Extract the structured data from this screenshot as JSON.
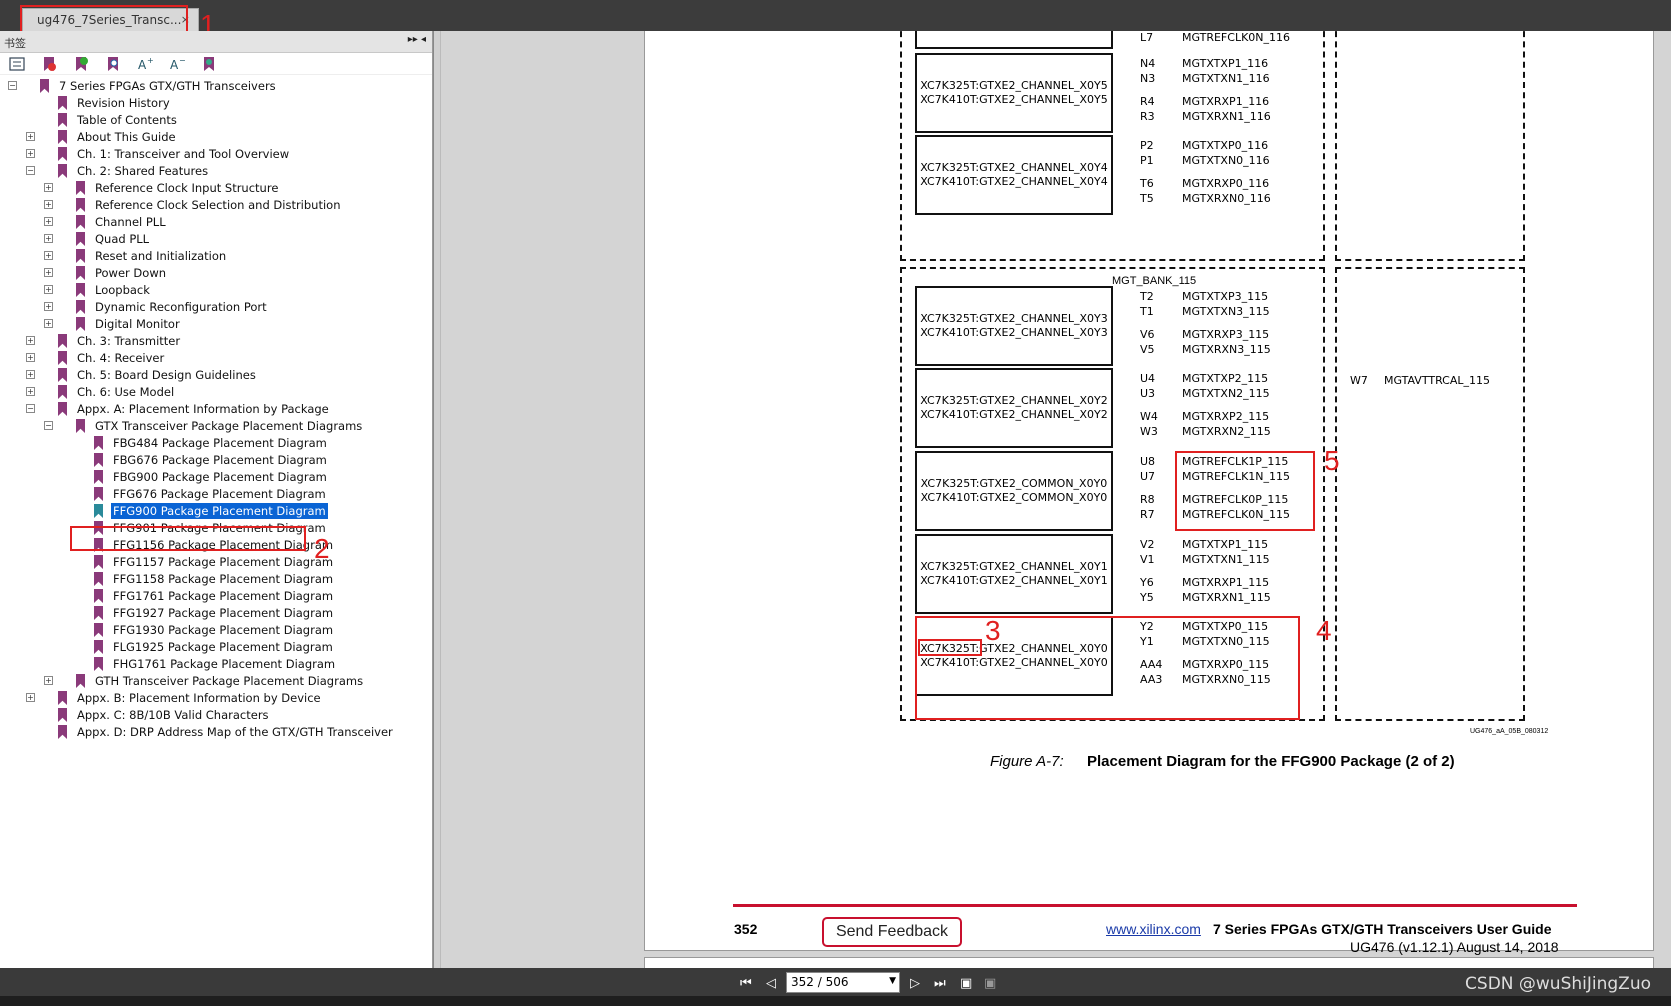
{
  "tab": {
    "title": "ug476_7Series_Transc...",
    "close": "×"
  },
  "annotations": {
    "a1": "1",
    "a2": "2",
    "a3": "3",
    "a4": "4",
    "a5": "5"
  },
  "sidebar": {
    "header": "书签",
    "header_controls": "▸▸ ◂"
  },
  "tree": [
    {
      "label": "7 Series FPGAs GTX/GTH Transceivers",
      "level": 0,
      "exp": "−"
    },
    {
      "label": "Revision History",
      "level": 1
    },
    {
      "label": "Table of Contents",
      "level": 1
    },
    {
      "label": "About This Guide",
      "level": 1,
      "exp": "+"
    },
    {
      "label": "Ch. 1: Transceiver and Tool Overview",
      "level": 1,
      "exp": "+"
    },
    {
      "label": "Ch. 2: Shared Features",
      "level": 1,
      "exp": "−"
    },
    {
      "label": "Reference Clock Input Structure",
      "level": 2,
      "exp": "+"
    },
    {
      "label": "Reference Clock Selection and Distribution",
      "level": 2,
      "exp": "+"
    },
    {
      "label": "Channel PLL",
      "level": 2,
      "exp": "+"
    },
    {
      "label": "Quad PLL",
      "level": 2,
      "exp": "+"
    },
    {
      "label": "Reset and Initialization",
      "level": 2,
      "exp": "+"
    },
    {
      "label": "Power Down",
      "level": 2,
      "exp": "+"
    },
    {
      "label": "Loopback",
      "level": 2,
      "exp": "+"
    },
    {
      "label": "Dynamic Reconfiguration Port",
      "level": 2,
      "exp": "+"
    },
    {
      "label": "Digital Monitor",
      "level": 2,
      "exp": "+"
    },
    {
      "label": "Ch. 3: Transmitter",
      "level": 1,
      "exp": "+"
    },
    {
      "label": "Ch. 4: Receiver",
      "level": 1,
      "exp": "+"
    },
    {
      "label": "Ch. 5: Board Design Guidelines",
      "level": 1,
      "exp": "+"
    },
    {
      "label": "Ch. 6: Use Model",
      "level": 1,
      "exp": "+"
    },
    {
      "label": "Appx. A: Placement Information by Package",
      "level": 1,
      "exp": "−"
    },
    {
      "label": "GTX Transceiver Package Placement Diagrams",
      "level": 2,
      "exp": "−"
    },
    {
      "label": "FBG484 Package Placement Diagram",
      "level": 3
    },
    {
      "label": "FBG676 Package Placement Diagram",
      "level": 3
    },
    {
      "label": "FBG900 Package Placement Diagram",
      "level": 3
    },
    {
      "label": "FFG676 Package Placement Diagram",
      "level": 3
    },
    {
      "label": "FFG900 Package Placement Diagram",
      "level": 3,
      "selected": true
    },
    {
      "label": "FFG901 Package Placement Diagram",
      "level": 3
    },
    {
      "label": "FFG1156 Package Placement Diagram",
      "level": 3
    },
    {
      "label": "FFG1157 Package Placement Diagram",
      "level": 3
    },
    {
      "label": "FFG1158 Package Placement Diagram",
      "level": 3
    },
    {
      "label": "FFG1761 Package Placement Diagram",
      "level": 3
    },
    {
      "label": "FFG1927 Package Placement Diagram",
      "level": 3
    },
    {
      "label": "FFG1930 Package Placement Diagram",
      "level": 3
    },
    {
      "label": "FLG1925 Package Placement Diagram",
      "level": 3
    },
    {
      "label": "FHG1761 Package Placement Diagram",
      "level": 3
    },
    {
      "label": "GTH Transceiver Package Placement Diagrams",
      "level": 2,
      "exp": "+"
    },
    {
      "label": "Appx. B: Placement Information by Device",
      "level": 1,
      "exp": "+"
    },
    {
      "label": "Appx. C: 8B/10B Valid Characters",
      "level": 1
    },
    {
      "label": "Appx. D: DRP Address Map of the GTX/GTH Transceiver",
      "level": 1
    }
  ],
  "diagram": {
    "bank_label": "MGT_BANK_115",
    "top_pins": [
      [
        "L7",
        "MGTREFCLK0N_116"
      ]
    ],
    "ch116": [
      {
        "l1": "XC7K325T:GTXE2_CHANNEL_X0Y5",
        "l2": "XC7K410T:GTXE2_CHANNEL_X0Y5",
        "pins": [
          [
            "N4",
            "MGTXTXP1_116"
          ],
          [
            "N3",
            "MGTXTXN1_116"
          ],
          [
            "R4",
            "MGTXRXP1_116"
          ],
          [
            "R3",
            "MGTXRXN1_116"
          ]
        ]
      },
      {
        "l1": "XC7K325T:GTXE2_CHANNEL_X0Y4",
        "l2": "XC7K410T:GTXE2_CHANNEL_X0Y4",
        "pins": [
          [
            "P2",
            "MGTXTXP0_116"
          ],
          [
            "P1",
            "MGTXTXN0_116"
          ],
          [
            "T6",
            "MGTXRXP0_116"
          ],
          [
            "T5",
            "MGTXRXN0_116"
          ]
        ]
      }
    ],
    "ch115": [
      {
        "l1": "XC7K325T:GTXE2_CHANNEL_X0Y3",
        "l2": "XC7K410T:GTXE2_CHANNEL_X0Y3",
        "pins": [
          [
            "T2",
            "MGTXTXP3_115"
          ],
          [
            "T1",
            "MGTXTXN3_115"
          ],
          [
            "V6",
            "MGTXRXP3_115"
          ],
          [
            "V5",
            "MGTXRXN3_115"
          ]
        ]
      },
      {
        "l1": "XC7K325T:GTXE2_CHANNEL_X0Y2",
        "l2": "XC7K410T:GTXE2_CHANNEL_X0Y2",
        "pins": [
          [
            "U4",
            "MGTXTXP2_115"
          ],
          [
            "U3",
            "MGTXTXN2_115"
          ],
          [
            "W4",
            "MGTXRXP2_115"
          ],
          [
            "W3",
            "MGTXRXN2_115"
          ]
        ]
      },
      {
        "l1": "XC7K325T:GTXE2_COMMON_X0Y0",
        "l2": "XC7K410T:GTXE2_COMMON_X0Y0",
        "pins": [
          [
            "U8",
            "MGTREFCLK1P_115"
          ],
          [
            "U7",
            "MGTREFCLK1N_115"
          ],
          [
            "R8",
            "MGTREFCLK0P_115"
          ],
          [
            "R7",
            "MGTREFCLK0N_115"
          ]
        ]
      },
      {
        "l1": "XC7K325T:GTXE2_CHANNEL_X0Y1",
        "l2": "XC7K410T:GTXE2_CHANNEL_X0Y1",
        "pins": [
          [
            "V2",
            "MGTXTXP1_115"
          ],
          [
            "V1",
            "MGTXTXN1_115"
          ],
          [
            "Y6",
            "MGTXRXP1_115"
          ],
          [
            "Y5",
            "MGTXRXN1_115"
          ]
        ]
      },
      {
        "l1": "XC7K325T:GTXE2_CHANNEL_X0Y0",
        "l2": "XC7K410T:GTXE2_CHANNEL_X0Y0",
        "pins": [
          [
            "Y2",
            "MGTXTXP0_115"
          ],
          [
            "Y1",
            "MGTXTXN0_115"
          ],
          [
            "AA4",
            "MGTXRXP0_115"
          ],
          [
            "AA3",
            "MGTXRXN0_115"
          ]
        ]
      }
    ],
    "right_pin": [
      "W7",
      "MGTAVTTRCAL_115"
    ],
    "fig_id": "UG476_aA_05B_080312",
    "caption_num": "Figure A-7:",
    "caption_text": "Placement Diagram for the FFG900 Package (2 of 2)"
  },
  "footer": {
    "page_num": "352",
    "feedback": "Send Feedback",
    "link": "www.xilinx.com",
    "guide": "7 Series FPGAs GTX/GTH Transceivers User Guide",
    "version": "UG476 (v1.12.1) August 14, 2018"
  },
  "statusbar": {
    "page_field": "352 / 506",
    "watermark": "CSDN @wuShiJingZuo"
  },
  "colors": {
    "annotation": "#e02020",
    "selection": "#0a64d4",
    "bookmark": "#8a3a7a"
  }
}
